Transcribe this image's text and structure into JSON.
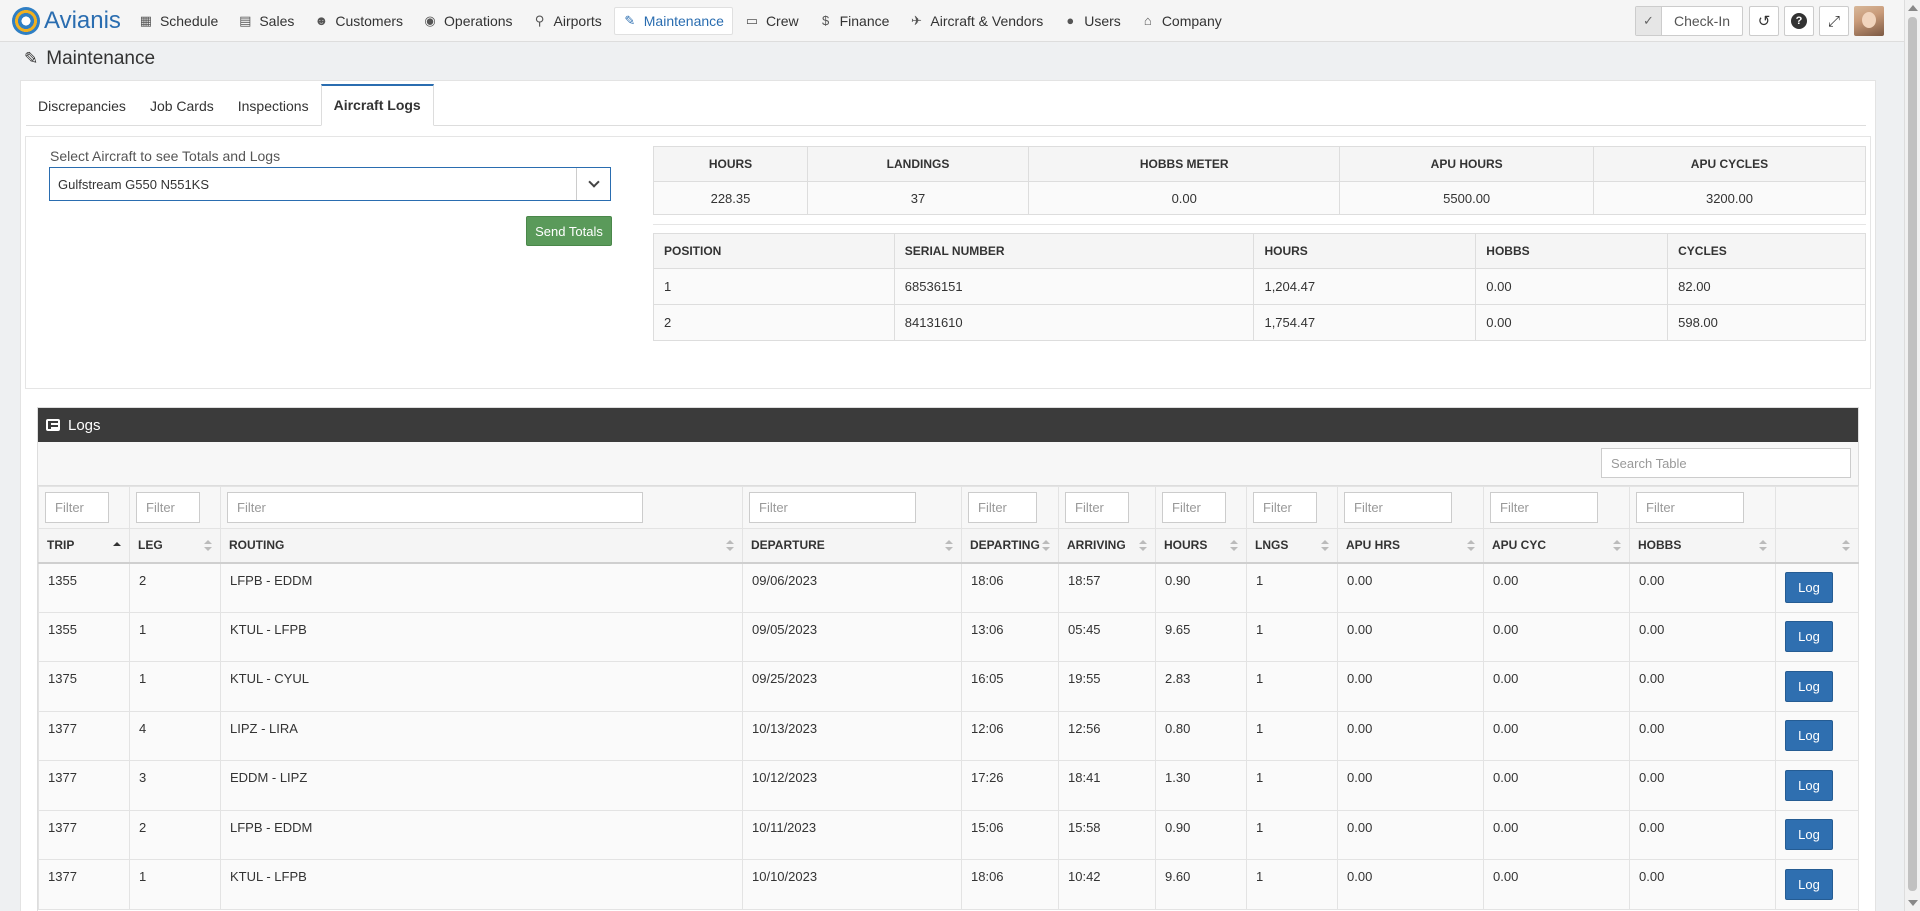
{
  "brand": {
    "name": "Avianis"
  },
  "nav": [
    {
      "label": "Schedule",
      "icon": "calendar-icon",
      "glyph": "▦"
    },
    {
      "label": "Sales",
      "icon": "document-icon",
      "glyph": "▤"
    },
    {
      "label": "Customers",
      "icon": "users-icon",
      "glyph": "☻"
    },
    {
      "label": "Operations",
      "icon": "globe-icon",
      "glyph": "◉"
    },
    {
      "label": "Airports",
      "icon": "map-marker-icon",
      "glyph": "⚲"
    },
    {
      "label": "Maintenance",
      "icon": "wrench-icon",
      "glyph": "✎",
      "active": true
    },
    {
      "label": "Crew",
      "icon": "id-card-icon",
      "glyph": "▭"
    },
    {
      "label": "Finance",
      "icon": "dollar-icon",
      "glyph": "$"
    },
    {
      "label": "Aircraft & Vendors",
      "icon": "plane-icon",
      "glyph": "✈"
    },
    {
      "label": "Users",
      "icon": "user-circle-icon",
      "glyph": "●"
    },
    {
      "label": "Company",
      "icon": "bank-icon",
      "glyph": "⌂"
    }
  ],
  "header_right": {
    "checkin_label": "Check-In"
  },
  "page": {
    "title": "Maintenance"
  },
  "tabs": [
    "Discrepancies",
    "Job Cards",
    "Inspections",
    "Aircraft Logs"
  ],
  "active_tab": "Aircraft Logs",
  "aircraft_select": {
    "label": "Select Aircraft to see Totals and Logs",
    "value": "Gulfstream G550 N551KS",
    "send_label": "Send Totals"
  },
  "totals": {
    "headers": [
      "HOURS",
      "LANDINGS",
      "HOBBS METER",
      "APU HOURS",
      "APU CYCLES"
    ],
    "values": [
      "228.35",
      "37",
      "0.00",
      "5500.00",
      "3200.00"
    ]
  },
  "engines": {
    "headers": [
      "POSITION",
      "SERIAL NUMBER",
      "HOURS",
      "HOBBS",
      "CYCLES"
    ],
    "rows": [
      [
        "1",
        "68536151",
        "1,204.47",
        "0.00",
        "82.00"
      ],
      [
        "2",
        "84131610",
        "1,754.47",
        "0.00",
        "598.00"
      ]
    ]
  },
  "logs": {
    "title": "Logs",
    "search_placeholder": "Search Table",
    "filter_placeholder": "Filter",
    "headers": [
      "TRIP",
      "LEG",
      "ROUTING",
      "DEPARTURE",
      "DEPARTING",
      "ARRIVING",
      "HOURS",
      "LNGS",
      "APU HRS",
      "APU CYC",
      "HOBBS",
      ""
    ],
    "button_label": "Log",
    "rows": [
      [
        "1355",
        "2",
        "LFPB - EDDM",
        "09/06/2023",
        "18:06",
        "18:57",
        "0.90",
        "1",
        "0.00",
        "0.00",
        "0.00"
      ],
      [
        "1355",
        "1",
        "KTUL - LFPB",
        "09/05/2023",
        "13:06",
        "05:45",
        "9.65",
        "1",
        "0.00",
        "0.00",
        "0.00"
      ],
      [
        "1375",
        "1",
        "KTUL - CYUL",
        "09/25/2023",
        "16:05",
        "19:55",
        "2.83",
        "1",
        "0.00",
        "0.00",
        "0.00"
      ],
      [
        "1377",
        "4",
        "LIPZ - LIRA",
        "10/13/2023",
        "12:06",
        "12:56",
        "0.80",
        "1",
        "0.00",
        "0.00",
        "0.00"
      ],
      [
        "1377",
        "3",
        "EDDM - LIPZ",
        "10/12/2023",
        "17:26",
        "18:41",
        "1.30",
        "1",
        "0.00",
        "0.00",
        "0.00"
      ],
      [
        "1377",
        "2",
        "LFPB - EDDM",
        "10/11/2023",
        "15:06",
        "15:58",
        "0.90",
        "1",
        "0.00",
        "0.00",
        "0.00"
      ],
      [
        "1377",
        "1",
        "KTUL - LFPB",
        "10/10/2023",
        "18:06",
        "10:42",
        "9.60",
        "1",
        "0.00",
        "0.00",
        "0.00"
      ]
    ]
  }
}
